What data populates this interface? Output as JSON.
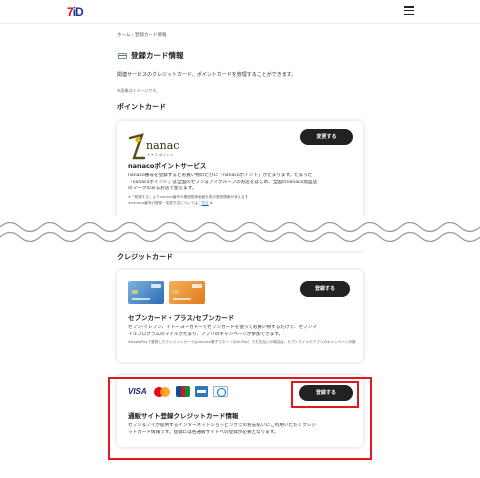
{
  "header": {
    "logo_seven": "7",
    "logo_d": "iD"
  },
  "breadcrumb": "ホーム  ›  登録カード情報",
  "page_title": "登録カード情報",
  "intro": "関連サービスのクレジットカード、ポイントカードを管理することができます。",
  "note": "※画像はイメージです。",
  "point_section": {
    "heading": "ポイントカード",
    "card": {
      "logo_text": "nanaco",
      "logo_sub": "ナナコ  ポイント",
      "change_label": "変更する",
      "title": "nanacoポイントサービス",
      "desc_lines": [
        "nanaco番号を登録するとお買い物のたびに「nanacoポイント」がたまります。たまった",
        "「nanacoポイント」は全国のセブン＆アイグループのお店をはじめ、全国のnanaco加盟店",
        "のマークのあるお店で使えます。"
      ],
      "small_line1": "※「登録する」よりnanaco番号の確認登録画面を表示登録情報が消えます",
      "small_line2_prefix": "※nanaco番号の登録・変更方法についてはこ",
      "small_line2_link": "ちら"
    }
  },
  "credit_section": {
    "heading": "クレジットカード",
    "card": {
      "register_label": "登録する",
      "title": "セブンカード・プラス/セブンカード",
      "desc_lines": [
        "セブン-イレブン、イトーヨーカドーでセブンカードを使ってお買い物するだけで、セブンマ",
        "イルプログラムのマイルがたまり、アプリのキャンペーンが参加できます。"
      ],
      "small_line": "※ApplePayで登録したクレジットカードはnanaco電子マネー（QUICPay）でお支払いの場合は、セブンマイルやアプリのキャンペーン対象外となります。"
    },
    "card2": {
      "brands": {
        "visa": "VISA"
      },
      "register_label": "登録する",
      "title": "通販サイト登録クレジットカード情報",
      "desc_lines": [
        "セブン＆アイが提供するインターネットショッピングでのお支払いにご利用いただくクレジ",
        "ットカード情報です。登録には各通販サイトへの登録が必要となります。"
      ]
    }
  },
  "colors": {
    "highlight": "#e0191f",
    "button": "#222222",
    "brand_red": "#e60012"
  }
}
